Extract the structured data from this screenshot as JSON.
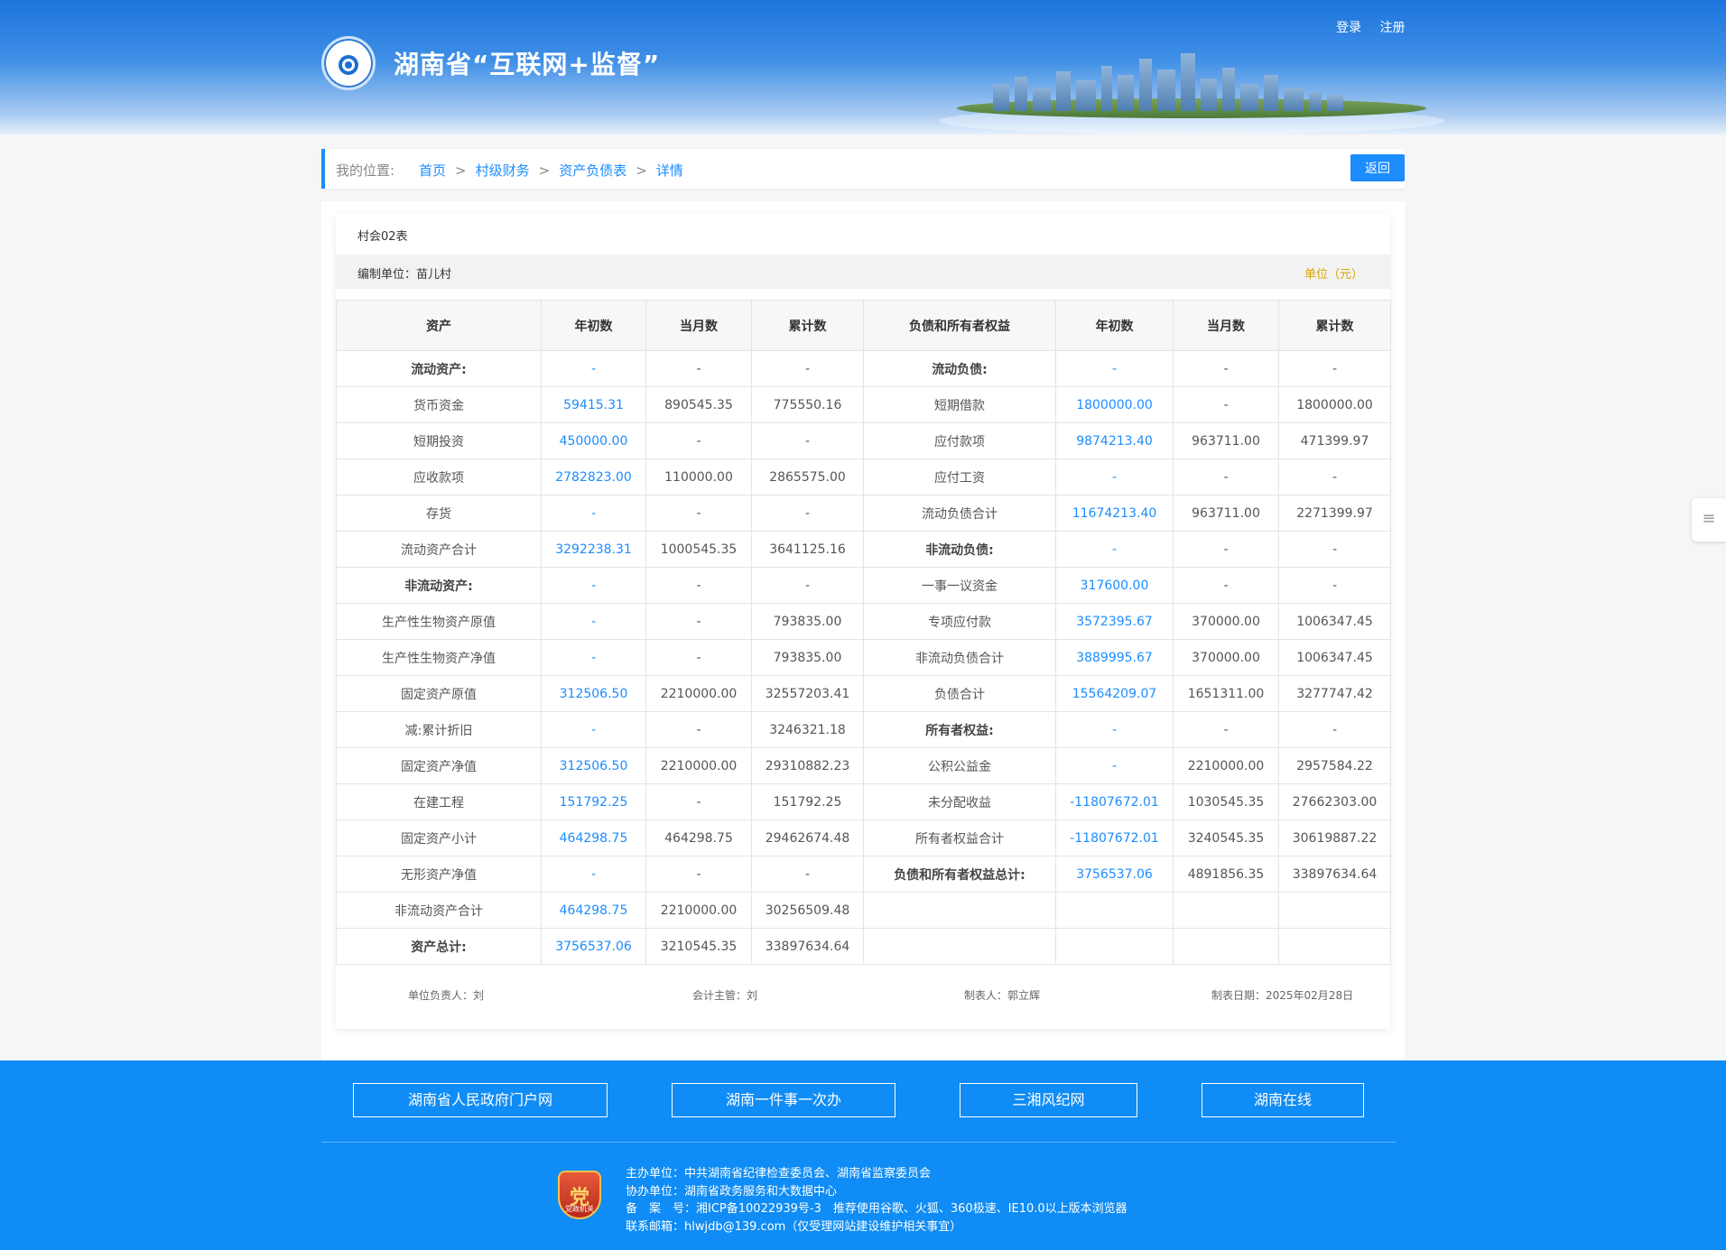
{
  "header": {
    "title": "湖南省“互联网+监督”",
    "login": "登录",
    "register": "注册"
  },
  "breadcrumb": {
    "label": "我的位置:",
    "items": [
      "首页",
      "村级财务",
      "资产负债表",
      "详情"
    ],
    "back": "返回"
  },
  "report": {
    "form_code": "村会02表",
    "org": "编制单位：苗儿村",
    "unit": "单位（元）",
    "headers": [
      "资产",
      "年初数",
      "当月数",
      "累计数",
      "负债和所有者权益",
      "年初数",
      "当月数",
      "累计数"
    ],
    "rows": [
      [
        "流动资产:",
        "-",
        "-",
        "-",
        "流动负债:",
        "-",
        "-",
        "-"
      ],
      [
        "货币资金",
        "59415.31",
        "890545.35",
        "775550.16",
        "短期借款",
        "1800000.00",
        "-",
        "1800000.00"
      ],
      [
        "短期投资",
        "450000.00",
        "-",
        "-",
        "应付款项",
        "9874213.40",
        "963711.00",
        "471399.97"
      ],
      [
        "应收款项",
        "2782823.00",
        "110000.00",
        "2865575.00",
        "应付工资",
        "-",
        "-",
        "-"
      ],
      [
        "存货",
        "-",
        "-",
        "-",
        "流动负债合计",
        "11674213.40",
        "963711.00",
        "2271399.97"
      ],
      [
        "流动资产合计",
        "3292238.31",
        "1000545.35",
        "3641125.16",
        "非流动负债:",
        "-",
        "-",
        "-"
      ],
      [
        "非流动资产:",
        "-",
        "-",
        "-",
        "一事一议资金",
        "317600.00",
        "-",
        "-"
      ],
      [
        "生产性生物资产原值",
        "-",
        "-",
        "793835.00",
        "专项应付款",
        "3572395.67",
        "370000.00",
        "1006347.45"
      ],
      [
        "生产性生物资产净值",
        "-",
        "-",
        "793835.00",
        "非流动负债合计",
        "3889995.67",
        "370000.00",
        "1006347.45"
      ],
      [
        "固定资产原值",
        "312506.50",
        "2210000.00",
        "32557203.41",
        "负债合计",
        "15564209.07",
        "1651311.00",
        "3277747.42"
      ],
      [
        "减:累计折旧",
        "-",
        "-",
        "3246321.18",
        "所有者权益:",
        "-",
        "-",
        "-"
      ],
      [
        "固定资产净值",
        "312506.50",
        "2210000.00",
        "29310882.23",
        "公积公益金",
        "-",
        "2210000.00",
        "2957584.22"
      ],
      [
        "在建工程",
        "151792.25",
        "-",
        "151792.25",
        "未分配收益",
        "-11807672.01",
        "1030545.35",
        "27662303.00"
      ],
      [
        "固定资产小计",
        "464298.75",
        "464298.75",
        "29462674.48",
        "所有者权益合计",
        "-11807672.01",
        "3240545.35",
        "30619887.22"
      ],
      [
        "无形资产净值",
        "-",
        "-",
        "-",
        "负债和所有者权益总计:",
        "3756537.06",
        "4891856.35",
        "33897634.64"
      ],
      [
        "非流动资产合计",
        "464298.75",
        "2210000.00",
        "30256509.48",
        "",
        "",
        "",
        ""
      ],
      [
        "资产总计:",
        "3756537.06",
        "3210545.35",
        "33897634.64",
        "",
        "",
        "",
        ""
      ]
    ],
    "bold_labels": [
      "流动资产:",
      "非流动资产:",
      "资产总计:",
      "流动负债:",
      "非流动负债:",
      "所有者权益:",
      "负债和所有者权益总计:"
    ],
    "signatures": {
      "head": "单位负责人：刘",
      "accountant": "会计主管：刘",
      "preparer": "制表人：郭立辉",
      "date": "制表日期：2025年02月28日"
    }
  },
  "footer": {
    "links": [
      "湖南省人民政府门户网",
      "湖南一件事一次办",
      "三湘风纪网",
      "湖南在线"
    ],
    "badge_text": "党政机关",
    "info": [
      "主办单位：中共湖南省纪律检查委员会、湖南省监察委员会",
      "协办单位：湖南省政务服务和大数据中心",
      "备　案　号：湘ICP备10022939号-3　推荐使用谷歌、火狐、360极速、IE10.0以上版本浏览器",
      "联系邮箱：hlwjdb@139.com（仅受理网站建设维护相关事宜）"
    ]
  },
  "colors": {
    "link": "#1c8cff",
    "header_blue": "#1d74dc",
    "footer_blue": "#0f8cf5",
    "unit_gold": "#d9a400"
  },
  "icons": {
    "logo": "eye-emblem-icon",
    "badge": "party-govt-badge-icon",
    "side_tab": "menu-list-icon"
  }
}
